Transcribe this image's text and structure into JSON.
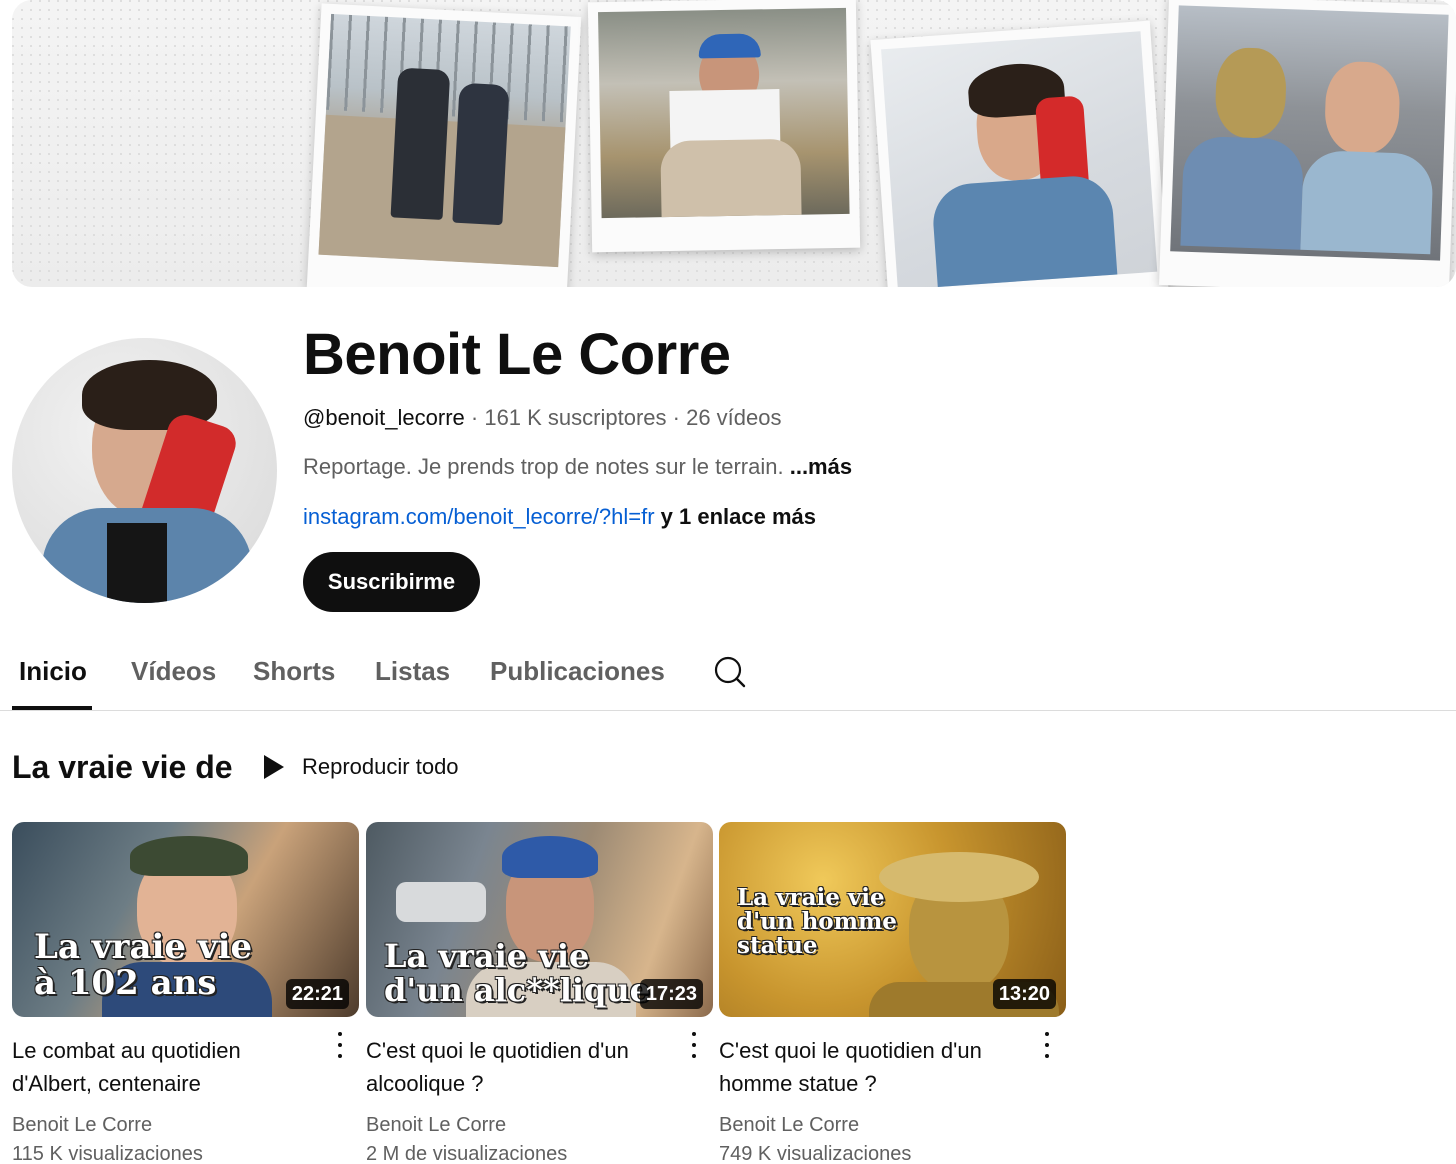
{
  "channel": {
    "name": "Benoit Le Corre",
    "handle": "@benoit_lecorre",
    "subscribers": "161 K suscriptores",
    "videos_count": "26 vídeos",
    "separator": " · ",
    "description": "Reportage. Je prends trop de notes sur le terrain. ",
    "description_more": "...más",
    "link": "instagram.com/benoit_lecorre/?hl=fr",
    "link_extra": " y 1 enlace más",
    "subscribe_label": "Suscribirme"
  },
  "tabs": [
    {
      "label": "Inicio",
      "active": true
    },
    {
      "label": "Vídeos",
      "active": false
    },
    {
      "label": "Shorts",
      "active": false
    },
    {
      "label": "Listas",
      "active": false
    },
    {
      "label": "Publicaciones",
      "active": false
    }
  ],
  "shelf": {
    "title": "La vraie vie de",
    "play_all_label": "Reproducir todo"
  },
  "videos": [
    {
      "thumb_line1": "La vraie vie",
      "thumb_line2": "à 102 ans",
      "duration": "22:21",
      "title": "Le combat au quotidien d'Albert, centenaire",
      "channel": "Benoit Le Corre",
      "views": "115 K visualizaciones"
    },
    {
      "thumb_line1": "La vraie vie",
      "thumb_line2": "d'un alc**lique",
      "duration": "17:23",
      "title": "C'est quoi le quotidien d'un alcoolique ?",
      "channel": "Benoit Le Corre",
      "views": "2 M de visualizaciones"
    },
    {
      "thumb_line1": "La vraie vie",
      "thumb_line2": "d'un homme",
      "thumb_line3": "statue",
      "duration": "13:20",
      "title": "C'est quoi le quotidien d'un homme statue ?",
      "channel": "Benoit Le Corre",
      "views": "749 K visualizaciones"
    }
  ],
  "icons": {
    "search": "search-icon",
    "play": "play-icon",
    "more": "more-vert-icon"
  },
  "colors": {
    "text_primary": "#0f0f0f",
    "text_secondary": "#606060",
    "link": "#065fd4",
    "subscribe_bg": "#0f0f0f"
  }
}
